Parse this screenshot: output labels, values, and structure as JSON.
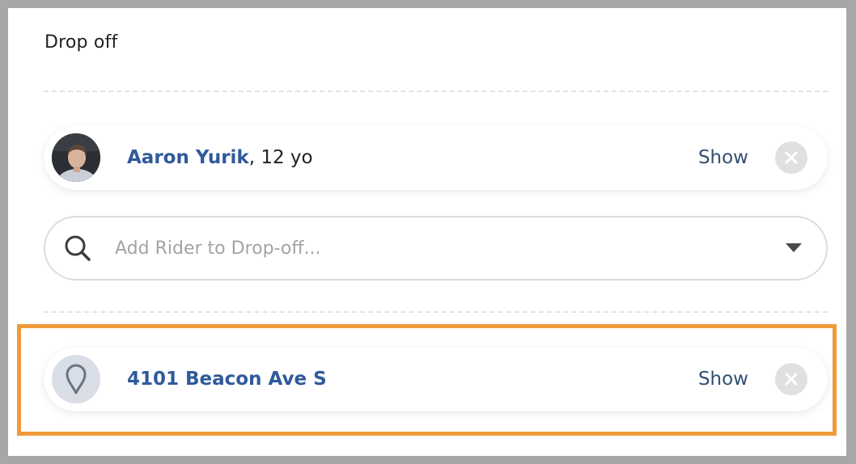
{
  "section": {
    "title": "Drop off"
  },
  "rider": {
    "name": "Aaron Yurik",
    "age_text": ", 12 yo",
    "show_label": "Show"
  },
  "search": {
    "placeholder": "Add Rider to Drop-off..."
  },
  "location": {
    "address": "4101 Beacon Ave S",
    "show_label": "Show"
  },
  "colors": {
    "link": "#2f5a9b",
    "highlight": "#f0993a",
    "background": "#a7a7a7"
  }
}
